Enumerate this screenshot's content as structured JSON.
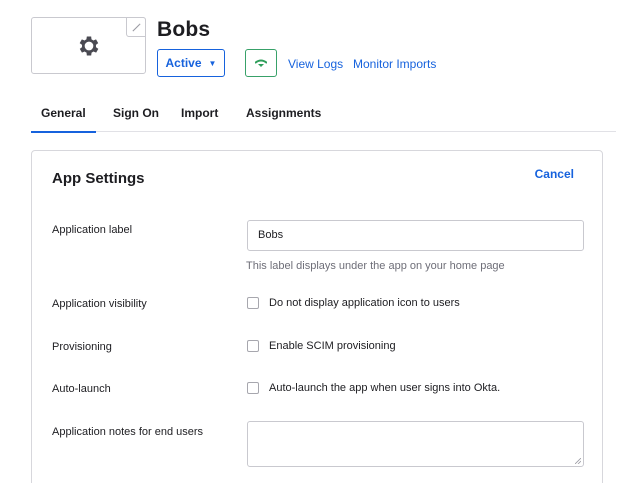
{
  "app": {
    "title": "Bobs",
    "logo_icon": "gear-icon",
    "edit_icon": "pencil-icon"
  },
  "header": {
    "status_label": "Active",
    "status_caret": "▼",
    "push_icon": "green-push-icon",
    "view_logs": "View Logs",
    "monitor_imports": "Monitor Imports"
  },
  "tabs": [
    {
      "label": "General",
      "active": true
    },
    {
      "label": "Sign On",
      "active": false
    },
    {
      "label": "Import",
      "active": false
    },
    {
      "label": "Assignments",
      "active": false
    }
  ],
  "settings": {
    "title": "App Settings",
    "cancel_label": "Cancel",
    "application_label": {
      "label": "Application label",
      "value": "Bobs",
      "helper": "This label displays under the app on your home page"
    },
    "visibility": {
      "label": "Application visibility",
      "checkbox_label": "Do not display application icon to users",
      "checked": false
    },
    "provisioning": {
      "label": "Provisioning",
      "checkbox_label": "Enable SCIM provisioning",
      "checked": false
    },
    "auto_launch": {
      "label": "Auto-launch",
      "checkbox_label": "Auto-launch the app when user signs into Okta.",
      "checked": false
    },
    "notes": {
      "label": "Application notes for end users",
      "value": ""
    }
  },
  "colors": {
    "accent": "#1662dd",
    "success": "#38a169",
    "text": "#1d1d21",
    "muted": "#6e6e78"
  }
}
